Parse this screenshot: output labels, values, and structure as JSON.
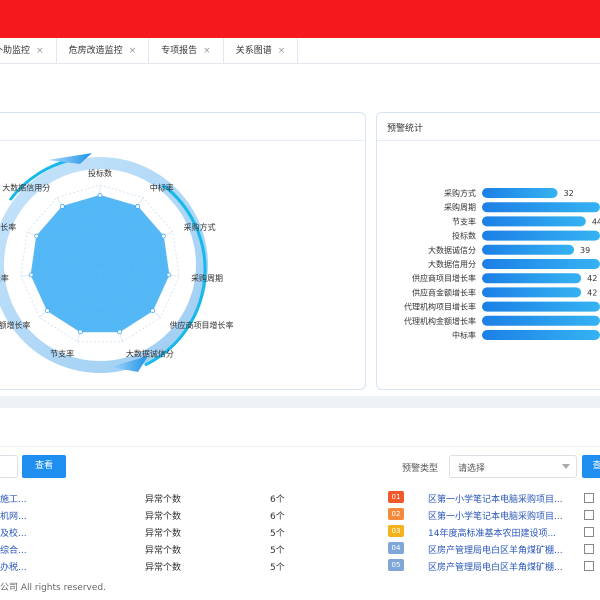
{
  "tabs": [
    {
      "label": "补助监控"
    },
    {
      "label": "危房改造监控"
    },
    {
      "label": "专项报告"
    },
    {
      "label": "关系图谱"
    }
  ],
  "tab_close_glyph": "×",
  "left_panel": {
    "title": ""
  },
  "right_panel": {
    "title": "预警统计"
  },
  "chart_data": [
    {
      "type": "radar",
      "indicators": [
        "投标数",
        "中标率",
        "采购方式",
        "采购周期",
        "供应商项目增长率",
        "大数据诚信分",
        "节支率",
        "金额增长率",
        "增长率",
        "目增长率",
        "大数据信用分"
      ],
      "values": [
        0.87,
        0.87,
        0.87,
        0.87,
        0.87,
        0.87,
        0.87,
        0.87,
        0.87,
        0.87,
        0.87
      ]
    },
    {
      "type": "bar",
      "categories": [
        "采购方式",
        "采购周期",
        "节支率",
        "投标数",
        "大数据诚信分",
        "大数据信用分",
        "供应商项目增长率",
        "供应商金额增长率",
        "代理机构项目增长率",
        "代理机构金额增长率",
        "中标率"
      ],
      "values": [
        32,
        50,
        44,
        50,
        39,
        50,
        42,
        42,
        50,
        50,
        50
      ],
      "labels": [
        "32",
        "",
        "44",
        "",
        "39",
        "",
        "42",
        "42",
        "",
        "",
        ""
      ]
    }
  ],
  "toolbar": {
    "view_label": "查看",
    "warning_type_label": "预警类型",
    "select_placeholder": "请选择",
    "view2_label": "查"
  },
  "left_list": [
    {
      "name": "施工...",
      "type": "异常个数",
      "count": "6个"
    },
    {
      "name": "机网...",
      "type": "异常个数",
      "count": "6个"
    },
    {
      "name": "及校...",
      "type": "异常个数",
      "count": "5个"
    },
    {
      "name": "综合...",
      "type": "异常个数",
      "count": "5个"
    },
    {
      "name": "办税...",
      "type": "异常个数",
      "count": "5个"
    }
  ],
  "right_list": [
    {
      "rank": "01",
      "title": "区第一小学笔记本电脑采购项目...",
      "color": "#f05a2b"
    },
    {
      "rank": "02",
      "title": "区第一小学笔记本电脑采购项目...",
      "color": "#f38a3b"
    },
    {
      "rank": "03",
      "title": "14年度高标准基本农田建设项...",
      "color": "#f5b21a"
    },
    {
      "rank": "04",
      "title": "区房产管理局电白区羊角煤矿棚...",
      "color": "#7fa5d9"
    },
    {
      "rank": "05",
      "title": "区房产管理局电白区羊角煤矿棚...",
      "color": "#7fa5d9"
    }
  ],
  "footer": {
    "text": "公司 All rights reserved."
  },
  "colors": {
    "accent": "#1e8ff0",
    "topbar": "#f5191e",
    "link": "#2856b8"
  }
}
